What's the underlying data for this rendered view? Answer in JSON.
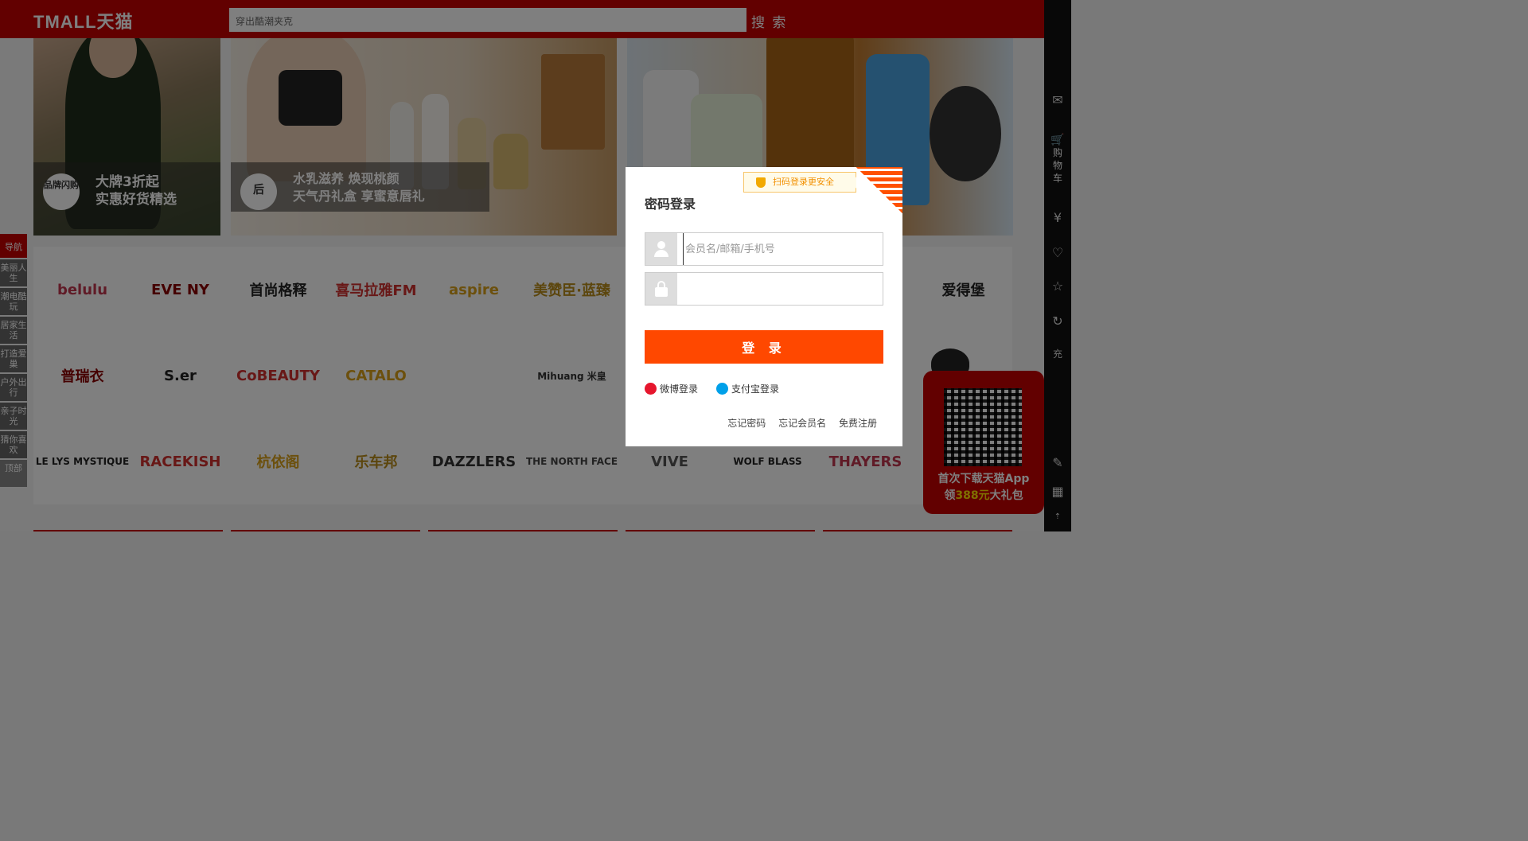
{
  "header": {
    "logo": "TMALL天猫",
    "search_value": "穿出酷潮夹克",
    "search_button": "搜 索"
  },
  "banners": [
    {
      "caption_line1": "大牌3折起",
      "caption_line2": "实惠好货精选",
      "badge": "品牌闪购"
    },
    {
      "caption_line1": "水乳滋养 焕现桃颜",
      "caption_line2": "天气丹礼盒 享蜜意唇礼"
    },
    {}
  ],
  "left_nav": [
    "导航",
    "美丽人生",
    "潮电酷玩",
    "居家生活",
    "打造爱巢",
    "户外出行",
    "亲子时光",
    "猜你喜欢",
    "顶部"
  ],
  "brands": [
    [
      "belulu",
      "EVE NY",
      "首尚格释",
      "喜马拉雅FM",
      "aspire",
      "美赞臣·蓝臻",
      "",
      "",
      "",
      "爱得堡"
    ],
    [
      "普瑞衣",
      "S.er",
      "CoBEAUTY",
      "CATALO",
      "",
      "Mihuang 米皇",
      "",
      "",
      "",
      ""
    ],
    [
      "LE LYS MYSTIQUE",
      "RACEKISH",
      "杭依阁",
      "乐车邦",
      "DAZZLERS",
      "THE NORTH FACE",
      "VIVE",
      "WOLF BLASS",
      "THAYERS",
      ""
    ]
  ],
  "right_rail": {
    "cart_label": "购物车"
  },
  "promo": {
    "line1": "首次下载天猫App",
    "line2_prefix": "领",
    "amount": "388元",
    "line2_suffix": "大礼包"
  },
  "login": {
    "title": "密码登录",
    "qr_tip": "扫码登录更安全",
    "username_placeholder": "会员名/邮箱/手机号",
    "password_value": "",
    "submit": "登 录",
    "weibo": "微博登录",
    "alipay": "支付宝登录",
    "forgot_password": "忘记密码",
    "forgot_username": "忘记会员名",
    "register": "免费注册"
  },
  "colors": {
    "brand_red": "#c40000",
    "login_button": "#ff4800",
    "qr_tip_text": "#f29000"
  }
}
